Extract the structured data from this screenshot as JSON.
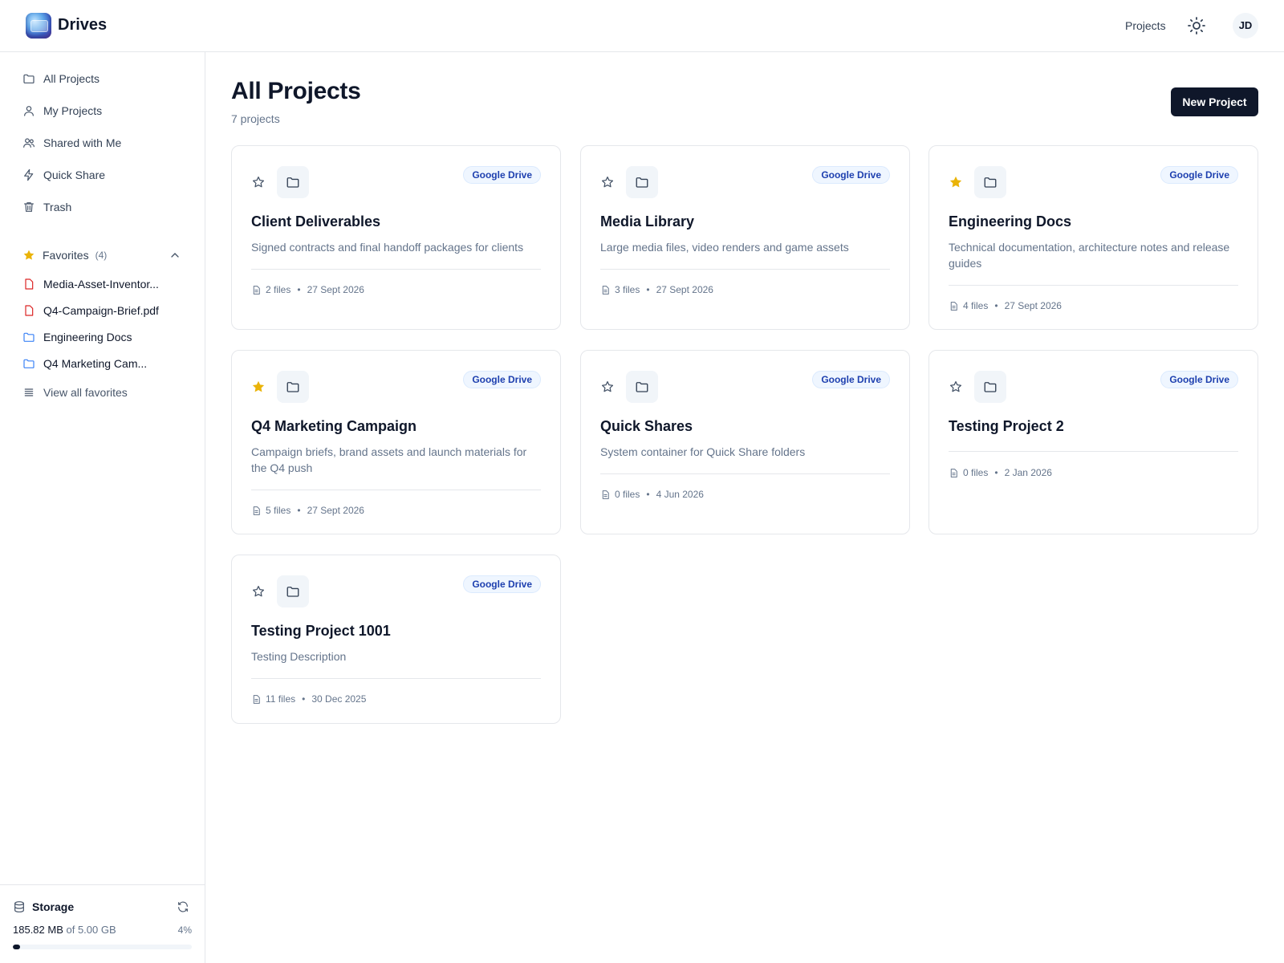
{
  "header": {
    "app_title": "Drives",
    "nav_projects": "Projects",
    "avatar_initials": "JD"
  },
  "sidebar": {
    "items": [
      {
        "label": "All Projects",
        "icon": "folder-icon"
      },
      {
        "label": "My Projects",
        "icon": "user-icon"
      },
      {
        "label": "Shared with Me",
        "icon": "users-icon"
      },
      {
        "label": "Quick Share",
        "icon": "zap-icon"
      },
      {
        "label": "Trash",
        "icon": "trash-icon"
      }
    ],
    "favorites": {
      "label": "Favorites",
      "count": "(4)",
      "items": [
        {
          "label": "Media-Asset-Inventor...",
          "icon": "file-icon"
        },
        {
          "label": "Q4-Campaign-Brief.pdf",
          "icon": "file-icon"
        },
        {
          "label": "Engineering Docs",
          "icon": "folder-icon"
        },
        {
          "label": "Q4 Marketing Cam...",
          "icon": "folder-icon"
        }
      ],
      "view_all": "View all favorites"
    },
    "storage": {
      "title": "Storage",
      "used": "185.82 MB",
      "of_total": "of 5.00 GB",
      "percent_label": "4%",
      "percent": 4
    }
  },
  "main": {
    "title": "All Projects",
    "count": "7 projects",
    "new_button": "New Project",
    "projects": [
      {
        "title": "Client Deliverables",
        "description": "Signed contracts and final handoff packages for clients",
        "badge": "Google Drive",
        "files": "2 files",
        "date": "27 Sept 2026",
        "starred": false
      },
      {
        "title": "Media Library",
        "description": "Large media files, video renders and game assets",
        "badge": "Google Drive",
        "files": "3 files",
        "date": "27 Sept 2026",
        "starred": false
      },
      {
        "title": "Engineering Docs",
        "description": "Technical documentation, architecture notes and release guides",
        "badge": "Google Drive",
        "files": "4 files",
        "date": "27 Sept 2026",
        "starred": true
      },
      {
        "title": "Q4 Marketing Campaign",
        "description": "Campaign briefs, brand assets and launch materials for the Q4 push",
        "badge": "Google Drive",
        "files": "5 files",
        "date": "27 Sept 2026",
        "starred": true
      },
      {
        "title": "Quick Shares",
        "description": "System container for Quick Share folders",
        "badge": "Google Drive",
        "files": "0 files",
        "date": "4 Jun 2026",
        "starred": false
      },
      {
        "title": "Testing Project 2",
        "description": "",
        "badge": "Google Drive",
        "files": "0 files",
        "date": "2 Jan 2026",
        "starred": false
      },
      {
        "title": "Testing Project 1001",
        "description": "Testing Description",
        "badge": "Google Drive",
        "files": "11 files",
        "date": "30 Dec 2025",
        "starred": false
      }
    ]
  },
  "colors": {
    "primary": "#0f172a",
    "muted": "#64748b",
    "border": "#e5e7eb",
    "star_active": "#eab308",
    "badge_text": "#1e40af",
    "badge_bg": "#eff6ff",
    "file_red": "#dc2626",
    "folder_blue": "#3b82f6"
  }
}
